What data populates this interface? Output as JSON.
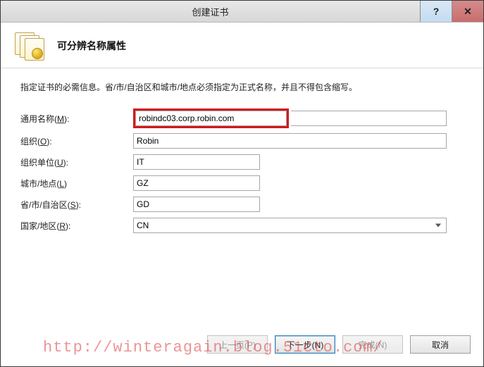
{
  "window": {
    "title": "创建证书"
  },
  "header": {
    "title": "可分辨名称属性"
  },
  "instructions": "指定证书的必需信息。省/市/自治区和城市/地点必须指定为正式名称，并且不得包含缩写。",
  "form": {
    "common_name": {
      "label": "通用名称(M):",
      "accesskey": "M",
      "value": "robindc03.corp.robin.com"
    },
    "organization": {
      "label": "组织(O):",
      "accesskey": "O",
      "value": "Robin"
    },
    "organizational_unit": {
      "label": "组织单位(U):",
      "accesskey": "U",
      "value": "IT"
    },
    "city": {
      "label": "城市/地点(L)",
      "accesskey": "L",
      "value": "GZ"
    },
    "state": {
      "label": "省/市/自治区(S):",
      "accesskey": "S",
      "value": "GD"
    },
    "country": {
      "label": "国家/地区(R):",
      "accesskey": "R",
      "value": "CN"
    }
  },
  "buttons": {
    "previous": "上一页(P)",
    "next": "下一步(N)",
    "finish": "完成(N)",
    "cancel": "取消"
  },
  "watermark": "http://winteragain.blog.51cto.com/"
}
